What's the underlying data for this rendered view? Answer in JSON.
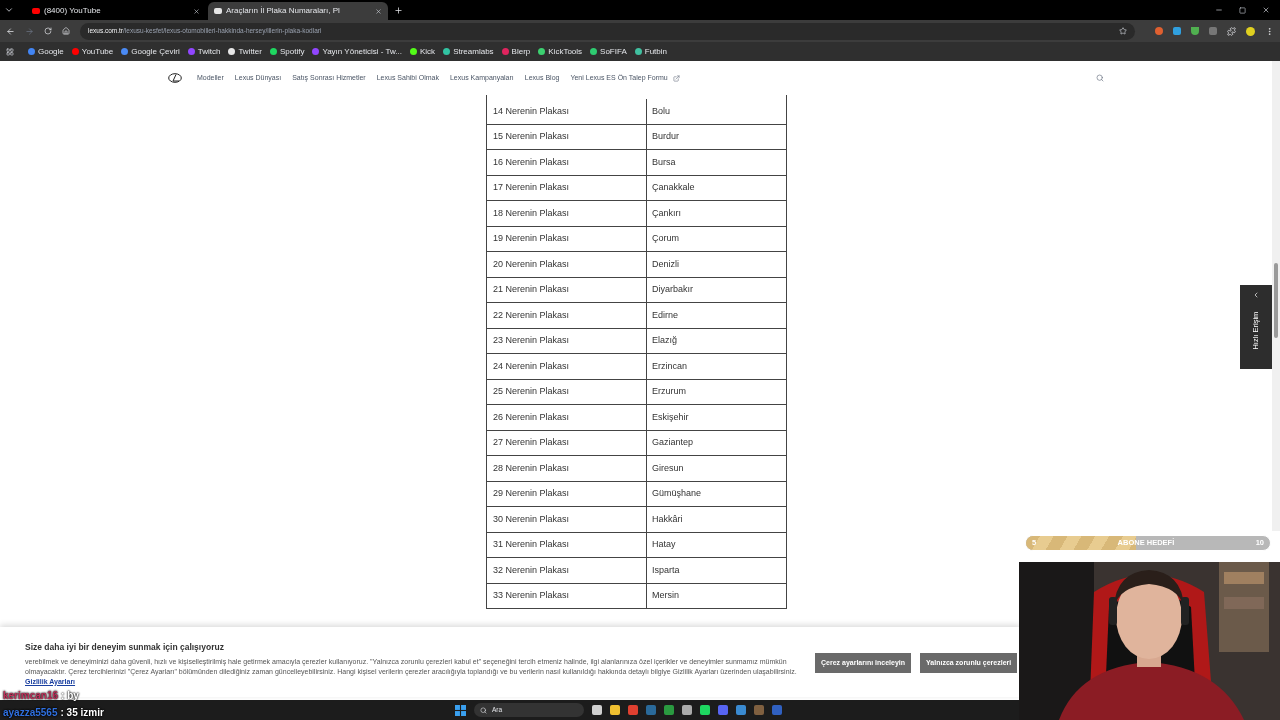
{
  "browser": {
    "tabs": [
      {
        "title": "(8400) YouTube",
        "selected": false,
        "color": "#ff0000"
      },
      {
        "title": "Araçların İl Plaka Numaraları, Pl",
        "selected": true,
        "color": "#e5e5e5"
      }
    ],
    "url_host": "lexus.com.tr",
    "url_path": "/lexusu-kesfet/lexus-otomobilleri-hakkinda-hersey/illerin-plaka-kodlari",
    "bookmarks": [
      {
        "label": "Google",
        "color": "#4285f4"
      },
      {
        "label": "YouTube",
        "color": "#ff0000"
      },
      {
        "label": "Google Çeviri",
        "color": "#4a8af4"
      },
      {
        "label": "Twitch",
        "color": "#9146ff"
      },
      {
        "label": "Twitter",
        "color": "#e7e7e7"
      },
      {
        "label": "Spotify",
        "color": "#1ed760"
      },
      {
        "label": "Yayın Yöneticisi - Tw...",
        "color": "#9146ff"
      },
      {
        "label": "Kick",
        "color": "#53fc18"
      },
      {
        "label": "Streamlabs",
        "color": "#31c3a2"
      },
      {
        "label": "Blerp",
        "color": "#e0245e"
      },
      {
        "label": "KickTools",
        "color": "#3cd070"
      },
      {
        "label": "SoFIFA",
        "color": "#2ecc71"
      },
      {
        "label": "Futbin",
        "color": "#40c0a0"
      }
    ]
  },
  "nav": {
    "items": [
      "Modeller",
      "Lexus Dünyası",
      "Satış Sonrası Hizmetler",
      "Lexus Sahibi Olmak",
      "Lexus Kampanyaları",
      "Lexus Blog",
      "Yeni Lexus ES Ön Talep Formu"
    ]
  },
  "table": {
    "rows": [
      [
        "14 Nerenin Plakası",
        "Bolu"
      ],
      [
        "15 Nerenin Plakası",
        "Burdur"
      ],
      [
        "16 Nerenin Plakası",
        "Bursa"
      ],
      [
        "17 Nerenin Plakası",
        "Çanakkale"
      ],
      [
        "18 Nerenin Plakası",
        "Çankırı"
      ],
      [
        "19 Nerenin Plakası",
        "Çorum"
      ],
      [
        "20 Nerenin Plakası",
        "Denizli"
      ],
      [
        "21 Nerenin Plakası",
        "Diyarbakır"
      ],
      [
        "22 Nerenin Plakası",
        "Edirne"
      ],
      [
        "23 Nerenin Plakası",
        "Elazığ"
      ],
      [
        "24 Nerenin Plakası",
        "Erzincan"
      ],
      [
        "25 Nerenin Plakası",
        "Erzurum"
      ],
      [
        "26 Nerenin Plakası",
        "Eskişehir"
      ],
      [
        "27 Nerenin Plakası",
        "Gaziantep"
      ],
      [
        "28 Nerenin Plakası",
        "Giresun"
      ],
      [
        "29 Nerenin Plakası",
        "Gümüşhane"
      ],
      [
        "30 Nerenin Plakası",
        "Hakkâri"
      ],
      [
        "31 Nerenin Plakası",
        "Hatay"
      ],
      [
        "32 Nerenin Plakası",
        "Isparta"
      ],
      [
        "33 Nerenin Plakası",
        "Mersin"
      ]
    ]
  },
  "quick_access": {
    "label": "Hızlı Erişim"
  },
  "cookie_banner": {
    "title": "Size daha iyi bir deneyim sunmak için çalışıyoruz",
    "text": "verebilmek ve deneyiminizi daha güvenli, hızlı ve kişiselleştirilmiş hale getirmek amacıyla çerezler kullanıyoruz. \"Yalnızca zorunlu çerezleri kabul et\" seçeneğini tercih etmeniz halinde, ilgi alanlarınıza özel içerikler ve deneyimler sunmamız mümkün olmayacaktır. Çerez tercihlerinizi \"Çerez Ayarları\" bölümünden dilediğiniz zaman güncelleyebilirsiniz. Hangi kişisel verilerin çerezler aracılığıyla toplandığı ve bu verilerin nasıl kullanıldığı hakkında detaylı bilgiye Gizlilik Ayarları üzerinden ulaşabilirsiniz.",
    "link": "Gizlilik Ayarları",
    "buttons": [
      "Çerez ayarlarını inceleyin",
      "Yalnızca zorunlu çerezleri"
    ]
  },
  "sub_goal": {
    "label": "ABONE HEDEFİ",
    "current": "5",
    "target": "10",
    "level": 0.45
  },
  "chat": [
    {
      "user": "kerimcan16",
      "message": ": by",
      "color": "#c0305a"
    },
    {
      "user": "ayazza5565",
      "message": ": 35 izmir",
      "color": "#3070e0"
    }
  ],
  "taskbar": {
    "search_placeholder": "Ara"
  }
}
